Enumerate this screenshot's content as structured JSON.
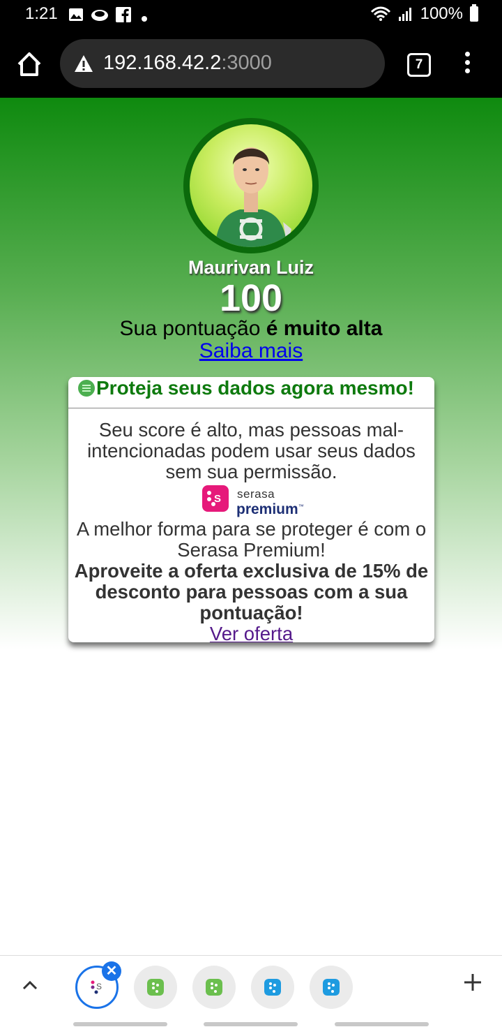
{
  "status_bar": {
    "time": "1:21",
    "battery": "100%"
  },
  "browser": {
    "url_host": "192.168.42.2",
    "url_port": ":3000",
    "tab_count": "7"
  },
  "profile": {
    "name": "Maurivan Luiz",
    "score": "100",
    "score_text_prefix": "Sua pontuação ",
    "score_text_bold": "é muito alta",
    "learn_more": "Saiba mais"
  },
  "card": {
    "title": "Proteja seus dados agora mesmo!",
    "paragraph1": "Seu score é alto, mas pessoas mal-intencionadas podem usar seus dados sem sua permissão.",
    "logo_line1": "serasa",
    "logo_line2": "premium",
    "logo_tm": "™",
    "paragraph2": "A melhor forma para se proteger é com o Serasa Premium!",
    "paragraph3": "Aproveite a oferta exclusiva de 15% de desconto para pessoas com a sua pontuação!",
    "offer_link": "Ver oferta"
  },
  "tab_bar": {
    "close_symbol": "✕",
    "tabs": [
      {
        "favicon": "serasa-icon",
        "color": "#ffffff",
        "active": true
      },
      {
        "favicon": "serasa-green-icon",
        "color": "#6bbf4e",
        "active": false
      },
      {
        "favicon": "serasa-green-icon",
        "color": "#6bbf4e",
        "active": false
      },
      {
        "favicon": "serasa-blue-icon",
        "color": "#1e9be0",
        "active": false
      },
      {
        "favicon": "serasa-blue-icon",
        "color": "#1e9be0",
        "active": false
      }
    ]
  },
  "colors": {
    "header_green": "#0f8a0f",
    "card_title_green": "#0e7a0e",
    "serasa_pink": "#e6197a",
    "serasa_navy": "#1d2f75",
    "tab_active_blue": "#1a73e8"
  }
}
